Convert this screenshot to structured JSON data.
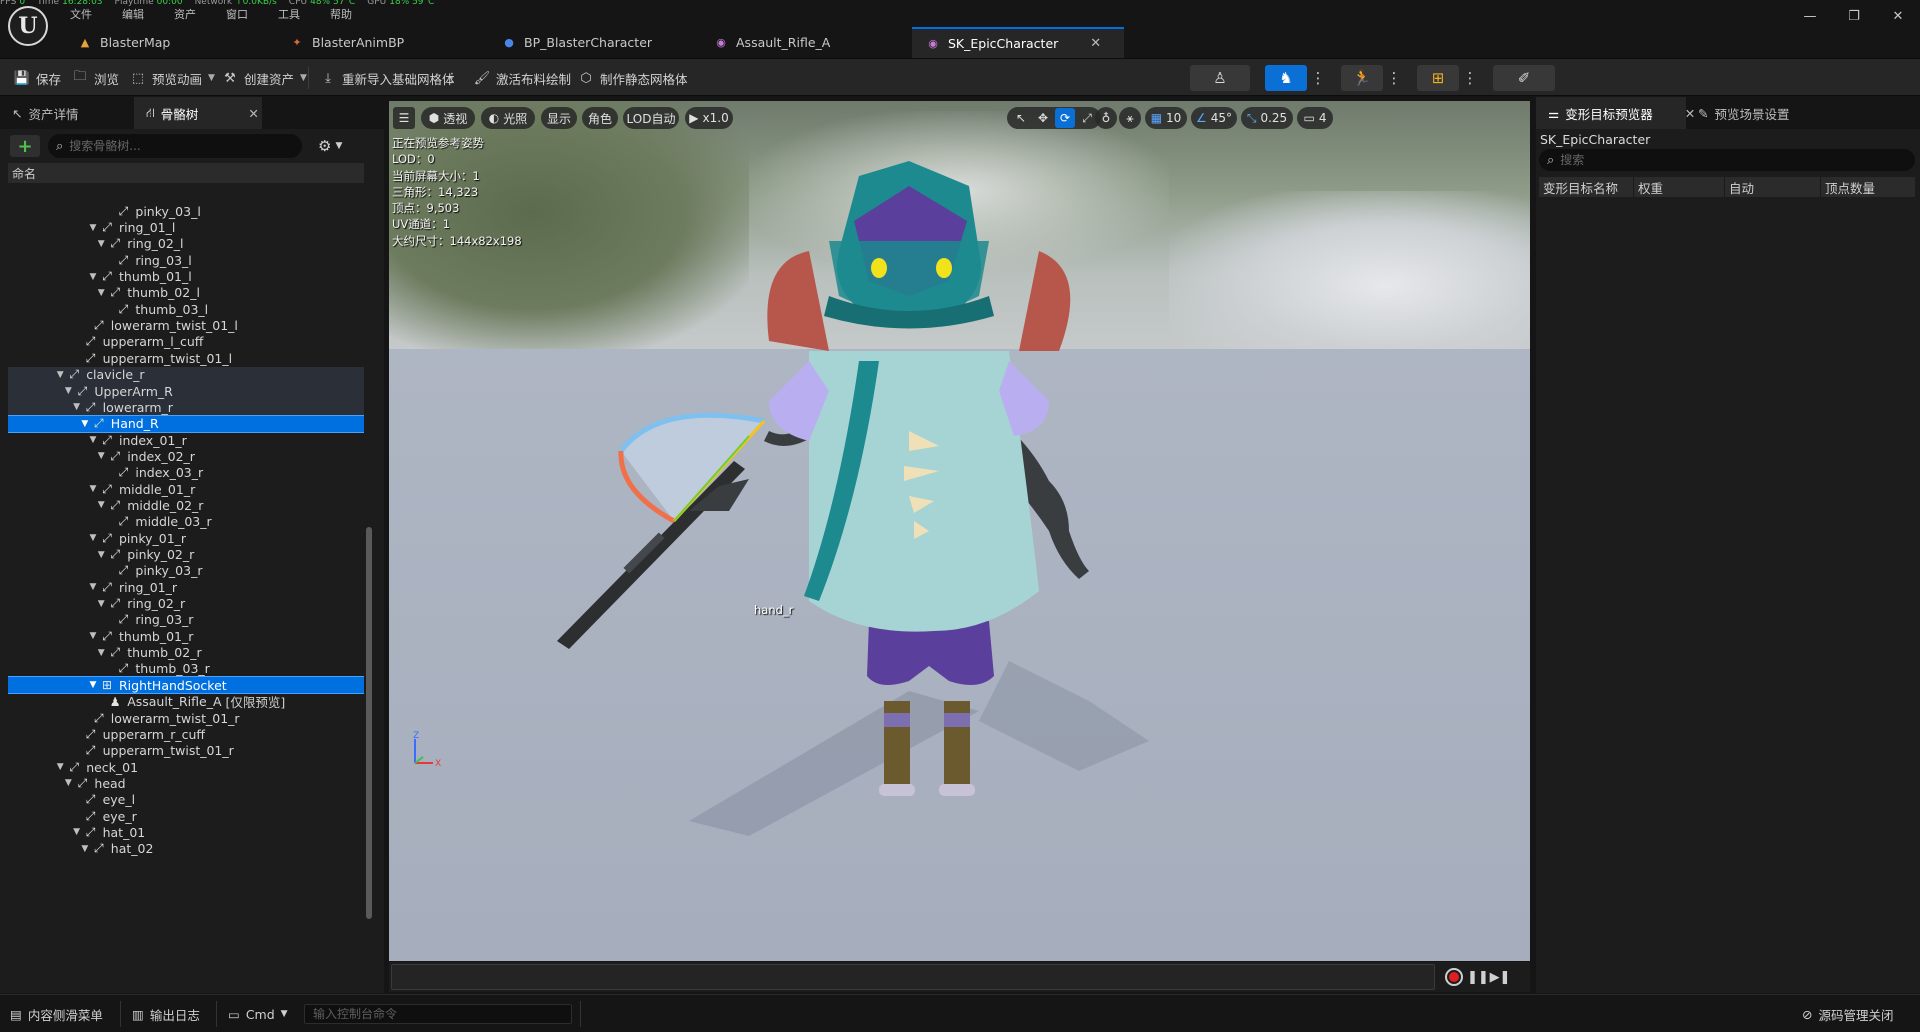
{
  "stats": [
    {
      "label": "FPS",
      "value": "0"
    },
    {
      "label": "Time",
      "value": "16:28:03"
    },
    {
      "label": "Playtime",
      "value": "00:00"
    },
    {
      "label": "Network",
      "value": "↑0.0KB/s"
    },
    {
      "label": "CPU",
      "value": "48% 57°C"
    },
    {
      "label": "GPU",
      "value": "18% 59°C"
    }
  ],
  "menu": [
    "文件",
    "编辑",
    "资产",
    "窗口",
    "工具",
    "帮助"
  ],
  "doc_tabs": [
    {
      "label": "BlasterMap",
      "icon": "map-icon"
    },
    {
      "label": "BlasterAnimBP",
      "icon": "anim-blueprint-icon"
    },
    {
      "label": "BP_BlasterCharacter",
      "icon": "character-blueprint-icon"
    },
    {
      "label": "Assault_Rifle_A",
      "icon": "skeletal-mesh-icon"
    },
    {
      "label": "SK_EpicCharacter",
      "icon": "skeletal-mesh-icon"
    }
  ],
  "toolbar": {
    "save": "保存",
    "browse": "浏览",
    "preview_animation": "预览动画",
    "create_asset": "创建资产",
    "reimport_base_mesh": "重新导入基础网格体",
    "activate_cloth_paint": "激活布料绘制",
    "make_static_mesh": "制作静态网格体"
  },
  "left_panel": {
    "tab_asset_details": "资产详情",
    "tab_skeleton_tree": "骨骼树",
    "search_placeholder": "搜索骨骼树...",
    "column_name": "命名"
  },
  "bone_tree": [
    {
      "label": "pinky_03_l",
      "depth": 7,
      "arrow": false,
      "type": "bone",
      "state": ""
    },
    {
      "label": "ring_01_l",
      "depth": 5,
      "arrow": true,
      "type": "bone",
      "state": ""
    },
    {
      "label": "ring_02_l",
      "depth": 6,
      "arrow": true,
      "type": "bone",
      "state": ""
    },
    {
      "label": "ring_03_l",
      "depth": 7,
      "arrow": false,
      "type": "bone",
      "state": ""
    },
    {
      "label": "thumb_01_l",
      "depth": 5,
      "arrow": true,
      "type": "bone",
      "state": ""
    },
    {
      "label": "thumb_02_l",
      "depth": 6,
      "arrow": true,
      "type": "bone",
      "state": ""
    },
    {
      "label": "thumb_03_l",
      "depth": 7,
      "arrow": false,
      "type": "bone",
      "state": ""
    },
    {
      "label": "lowerarm_twist_01_l",
      "depth": 4,
      "arrow": false,
      "type": "bone",
      "state": ""
    },
    {
      "label": "upperarm_l_cuff",
      "depth": 3,
      "arrow": false,
      "type": "bone",
      "state": ""
    },
    {
      "label": "upperarm_twist_01_l",
      "depth": 3,
      "arrow": false,
      "type": "bone",
      "state": ""
    },
    {
      "label": "clavicle_r",
      "depth": 1,
      "arrow": true,
      "type": "bone",
      "state": "band"
    },
    {
      "label": "UpperArm_R",
      "depth": 2,
      "arrow": true,
      "type": "bone",
      "state": "band"
    },
    {
      "label": "lowerarm_r",
      "depth": 3,
      "arrow": true,
      "type": "bone",
      "state": "band"
    },
    {
      "label": "Hand_R",
      "depth": 4,
      "arrow": true,
      "type": "bone",
      "state": "selected"
    },
    {
      "label": "index_01_r",
      "depth": 5,
      "arrow": true,
      "type": "bone",
      "state": ""
    },
    {
      "label": "index_02_r",
      "depth": 6,
      "arrow": true,
      "type": "bone",
      "state": ""
    },
    {
      "label": "index_03_r",
      "depth": 7,
      "arrow": false,
      "type": "bone",
      "state": ""
    },
    {
      "label": "middle_01_r",
      "depth": 5,
      "arrow": true,
      "type": "bone",
      "state": ""
    },
    {
      "label": "middle_02_r",
      "depth": 6,
      "arrow": true,
      "type": "bone",
      "state": ""
    },
    {
      "label": "middle_03_r",
      "depth": 7,
      "arrow": false,
      "type": "bone",
      "state": ""
    },
    {
      "label": "pinky_01_r",
      "depth": 5,
      "arrow": true,
      "type": "bone",
      "state": ""
    },
    {
      "label": "pinky_02_r",
      "depth": 6,
      "arrow": true,
      "type": "bone",
      "state": ""
    },
    {
      "label": "pinky_03_r",
      "depth": 7,
      "arrow": false,
      "type": "bone",
      "state": ""
    },
    {
      "label": "ring_01_r",
      "depth": 5,
      "arrow": true,
      "type": "bone",
      "state": ""
    },
    {
      "label": "ring_02_r",
      "depth": 6,
      "arrow": true,
      "type": "bone",
      "state": ""
    },
    {
      "label": "ring_03_r",
      "depth": 7,
      "arrow": false,
      "type": "bone",
      "state": ""
    },
    {
      "label": "thumb_01_r",
      "depth": 5,
      "arrow": true,
      "type": "bone",
      "state": ""
    },
    {
      "label": "thumb_02_r",
      "depth": 6,
      "arrow": true,
      "type": "bone",
      "state": ""
    },
    {
      "label": "thumb_03_r",
      "depth": 7,
      "arrow": false,
      "type": "bone",
      "state": ""
    },
    {
      "label": "RightHandSocket",
      "depth": 5,
      "arrow": true,
      "type": "socket",
      "state": "selected"
    },
    {
      "label": "Assault_Rifle_A",
      "suffix": "[仅限预览]",
      "depth": 6,
      "arrow": false,
      "type": "attached-mesh",
      "state": ""
    },
    {
      "label": "lowerarm_twist_01_r",
      "depth": 4,
      "arrow": false,
      "type": "bone",
      "state": ""
    },
    {
      "label": "upperarm_r_cuff",
      "depth": 3,
      "arrow": false,
      "type": "bone",
      "state": ""
    },
    {
      "label": "upperarm_twist_01_r",
      "depth": 3,
      "arrow": false,
      "type": "bone",
      "state": ""
    },
    {
      "label": "neck_01",
      "depth": 1,
      "arrow": true,
      "type": "bone",
      "state": ""
    },
    {
      "label": "head",
      "depth": 2,
      "arrow": true,
      "type": "bone",
      "state": ""
    },
    {
      "label": "eye_l",
      "depth": 3,
      "arrow": false,
      "type": "bone",
      "state": ""
    },
    {
      "label": "eye_r",
      "depth": 3,
      "arrow": false,
      "type": "bone",
      "state": ""
    },
    {
      "label": "hat_01",
      "depth": 3,
      "arrow": true,
      "type": "bone",
      "state": ""
    },
    {
      "label": "hat_02",
      "depth": 4,
      "arrow": true,
      "type": "bone",
      "state": ""
    }
  ],
  "viewport": {
    "btn_perspective": "透视",
    "btn_lighting": "光照",
    "btn_show": "显示",
    "btn_character": "角色",
    "btn_lod": "LOD自动",
    "btn_play_speed": "x1.0",
    "grid_snap": "10",
    "rotation_snap": "45°",
    "scale_snap": "0.25",
    "camera_speed": "4",
    "info_lines": [
      "正在预览参考姿势",
      "LOD：0",
      "当前屏幕大小：1",
      "三角形：14,323",
      "顶点：9,503",
      "UV通道：1",
      "大约尺寸：144x82x198"
    ],
    "selected_bone_label": "hand_r",
    "axis_z": "Z",
    "axis_x": "X"
  },
  "right_panel": {
    "tab_morph_preview": "变形目标预览器",
    "tab_preview_settings": "预览场景设置",
    "mesh_name": "SK_EpicCharacter",
    "search_placeholder": "搜索",
    "columns": [
      "变形目标名称",
      "权重",
      "自动",
      "顶点数量"
    ]
  },
  "statusbar": {
    "content_drawer": "内容侧滑菜单",
    "output_log": "输出日志",
    "cmd": "Cmd",
    "console_placeholder": "输入控制台命令",
    "source_control": "源码管理关闭"
  },
  "colors": {
    "accent_blue": "#0070e0",
    "toolbar_bg": "#262626",
    "panel_bg": "#1c1c1c",
    "stat_green": "#39d24a",
    "record_red": "#e02020",
    "character_teal": "#1c8a8e",
    "character_purple": "#5b3f9c"
  }
}
